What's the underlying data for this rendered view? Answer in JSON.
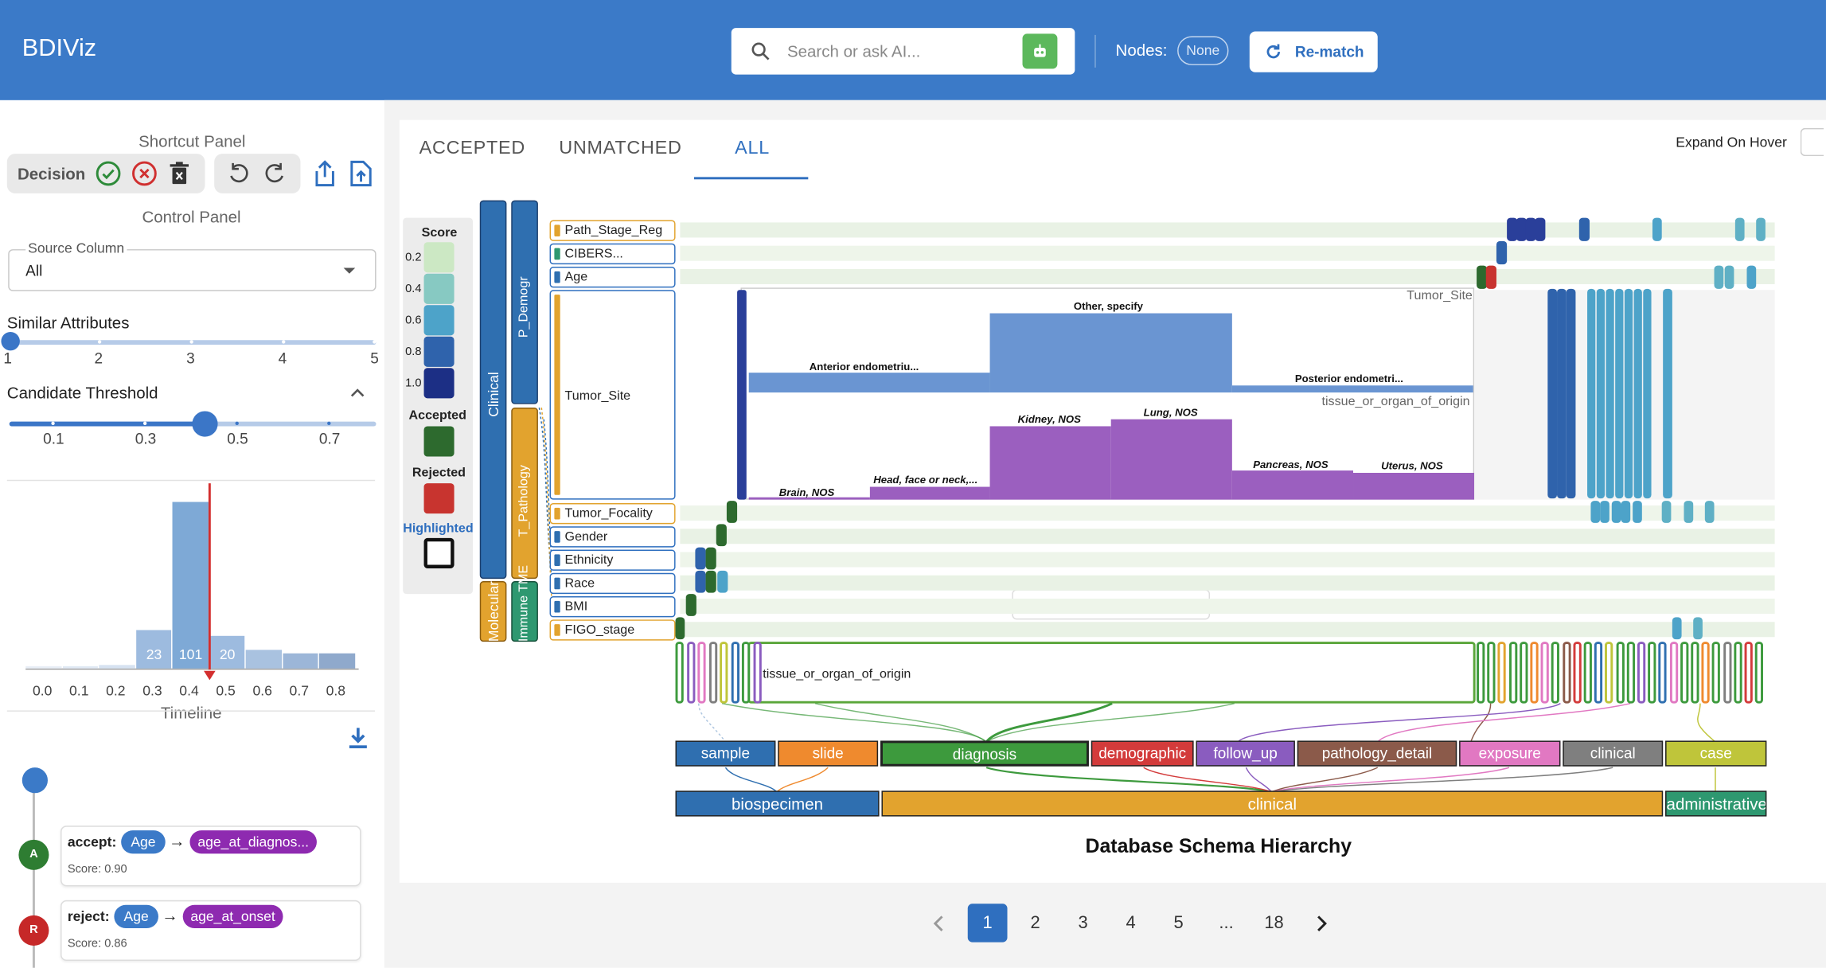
{
  "header": {
    "app_title": "BDIViz",
    "search_placeholder": "Search or ask AI...",
    "nodes_label": "Nodes:",
    "nodes_value": "None",
    "rematch_label": "Re-match"
  },
  "sidebar": {
    "shortcut_title": "Shortcut Panel",
    "decision_label": "Decision",
    "control_title": "Control Panel",
    "source_column": {
      "label": "Source Column",
      "value": "All"
    },
    "similar_attributes": {
      "label": "Similar Attributes",
      "ticks": [
        "1",
        "2",
        "3",
        "4",
        "5"
      ],
      "value": 1
    },
    "candidate_threshold": {
      "label": "Candidate Threshold",
      "ticks": [
        "0.1",
        "0.3",
        "0.5",
        "0.7"
      ],
      "value": 0.4
    },
    "histogram": {
      "x_ticks": [
        "0.0",
        "0.1",
        "0.2",
        "0.3",
        "0.4",
        "0.5",
        "0.6",
        "0.7",
        "0.8"
      ],
      "bins": [
        {
          "x": 0.0,
          "count": 1
        },
        {
          "x": 0.1,
          "count": 1
        },
        {
          "x": 0.2,
          "count": 2
        },
        {
          "x": 0.3,
          "count": 23,
          "label": "23"
        },
        {
          "x": 0.4,
          "count": 101,
          "label": "101"
        },
        {
          "x": 0.5,
          "count": 20,
          "label": "20"
        },
        {
          "x": 0.6,
          "count": 11
        },
        {
          "x": 0.7,
          "count": 9
        },
        {
          "x": 0.8,
          "count": 9
        }
      ],
      "threshold": 0.45
    },
    "timeline_title": "Timeline",
    "timeline": [
      {
        "badge": "A",
        "action": "accept:",
        "source": "Age",
        "target": "age_at_diagnos...",
        "score": "Score: 0.90",
        "color": "#2e7d32"
      },
      {
        "badge": "R",
        "action": "reject:",
        "source": "Age",
        "target": "age_at_onset",
        "score": "Score: 0.86",
        "color": "#c62828"
      }
    ]
  },
  "main": {
    "tabs": [
      "ACCEPTED",
      "UNMATCHED",
      "ALL"
    ],
    "active_tab": "ALL",
    "expand_label": "Expand On Hover",
    "legend": {
      "score_title": "Score",
      "scores": [
        "0.2",
        "0.4",
        "0.6",
        "0.8",
        "1.0"
      ],
      "score_colors": [
        "#cce8c4",
        "#87c9c2",
        "#4da3c9",
        "#2f63ac",
        "#1c2f85"
      ],
      "accepted_label": "Accepted",
      "accepted_color": "#2d6a2e",
      "rejected_label": "Rejected",
      "rejected_color": "#c8342f",
      "highlighted_label": "Highlighted"
    },
    "groups": {
      "clinical": "Clinical",
      "molecular": "Molecular",
      "p_demogr": "P_Demogr",
      "t_pathology": "T_Pathology",
      "immune_tme": "Immune TME"
    },
    "source_rows": [
      "Path_Stage_Reg",
      "CIBERS...",
      "Age",
      "Tumor_Site",
      "Tumor_Focality",
      "Gender",
      "Ethnicity",
      "Race",
      "BMI",
      "FIGO_stage"
    ],
    "expanded_panel": {
      "source_title": "Tumor_Site",
      "target_title": "tissue_or_organ_of_origin",
      "source_values": [
        "Anterior endometriu...",
        "Other, specify",
        "Posterior endometri..."
      ],
      "target_values": [
        "Brain, NOS",
        "Head, face or neck,...",
        "Kidney, NOS",
        "Lung, NOS",
        "Pancreas, NOS",
        "Uterus, NOS"
      ]
    },
    "tooltip": "tissue_or_organ_of_origin",
    "target_box_label": "tissue_or_organ_of_origin",
    "categories": [
      "sample",
      "slide",
      "diagnosis",
      "demographic",
      "follow_up",
      "pathology_detail",
      "exposure",
      "clinical",
      "case"
    ],
    "category_colors": [
      "#2f6fb0",
      "#ef8a2e",
      "#3d9a3d",
      "#d33b3b",
      "#8a5cbf",
      "#8b5a4a",
      "#e178c2",
      "#7f7f7f",
      "#bfc53a"
    ],
    "super_categories": [
      "biospecimen",
      "clinical",
      "administrative"
    ],
    "super_colors": [
      "#2f6fb0",
      "#e2a32e",
      "#2e9870"
    ],
    "schema_title": "Database Schema Hierarchy"
  },
  "pagination": {
    "pages": [
      "1",
      "2",
      "3",
      "4",
      "5",
      "...",
      "18"
    ],
    "current": "1"
  }
}
